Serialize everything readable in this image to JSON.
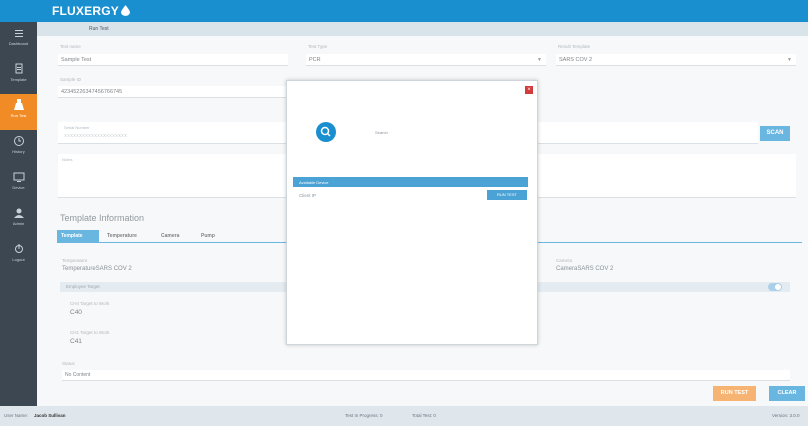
{
  "app": {
    "name": "FLUXERGY"
  },
  "subheader": {
    "title": "Run Test"
  },
  "sidebar": {
    "items": [
      {
        "label": "Dashboard",
        "icon": "menu-icon"
      },
      {
        "label": "Template",
        "icon": "document-icon"
      },
      {
        "label": "Run Test",
        "icon": "flask-icon",
        "active": true
      },
      {
        "label": "History",
        "icon": "clock-icon"
      },
      {
        "label": "Device",
        "icon": "monitor-icon"
      },
      {
        "label": "Admin",
        "icon": "person-icon"
      },
      {
        "label": "Logout",
        "icon": "power-icon"
      }
    ]
  },
  "form": {
    "test_name": {
      "label": "Test name",
      "value": "Sample Test"
    },
    "test_type": {
      "label": "Test Type",
      "value": "PCR"
    },
    "result_template": {
      "label": "Result Template",
      "value": "SARS COV 2"
    },
    "sample_id": {
      "label": "Sample ID",
      "value": "42345226347456766745"
    },
    "serial_number": {
      "label": "Serial Number",
      "placeholder": "XXXXXXXXXXXXXXXXXXXXX"
    },
    "notes": {
      "label": "Notes"
    },
    "scan_label": "SCAN"
  },
  "template_info": {
    "title": "Template Information",
    "tabs": [
      "Template",
      "Temperature",
      "Camera",
      "Pump"
    ],
    "temperature": {
      "label": "Temperature",
      "value": "TemperatureSARS COV 2"
    },
    "camera": {
      "label": "Camera",
      "value": "CameraSARS COV 2"
    },
    "strip_label": "Employee Target",
    "ch4": {
      "label": "CH4 Target to Work",
      "value": "C40"
    },
    "ch1": {
      "label": "CH1 Target to Work",
      "value": "C41"
    },
    "status": {
      "label": "Status",
      "value": "No Content"
    }
  },
  "actions": {
    "run_test": "RUN TEST",
    "clear": "CLEAR"
  },
  "statusbar": {
    "user_label": "User Name:",
    "user": "Jacob Sullivan",
    "in_progress": "Test In Progress: 0",
    "total": "Total Test: 0",
    "version": "Version: 3.0.0"
  },
  "modal": {
    "search_label": "Search",
    "list_header": "Available Device",
    "row_label": "Client IP",
    "row_button": "RUN TEST"
  },
  "colors": {
    "primary": "#1a8fd0",
    "accent": "#f18b26",
    "sidebar": "#3d4751",
    "danger": "#d23b3b"
  }
}
